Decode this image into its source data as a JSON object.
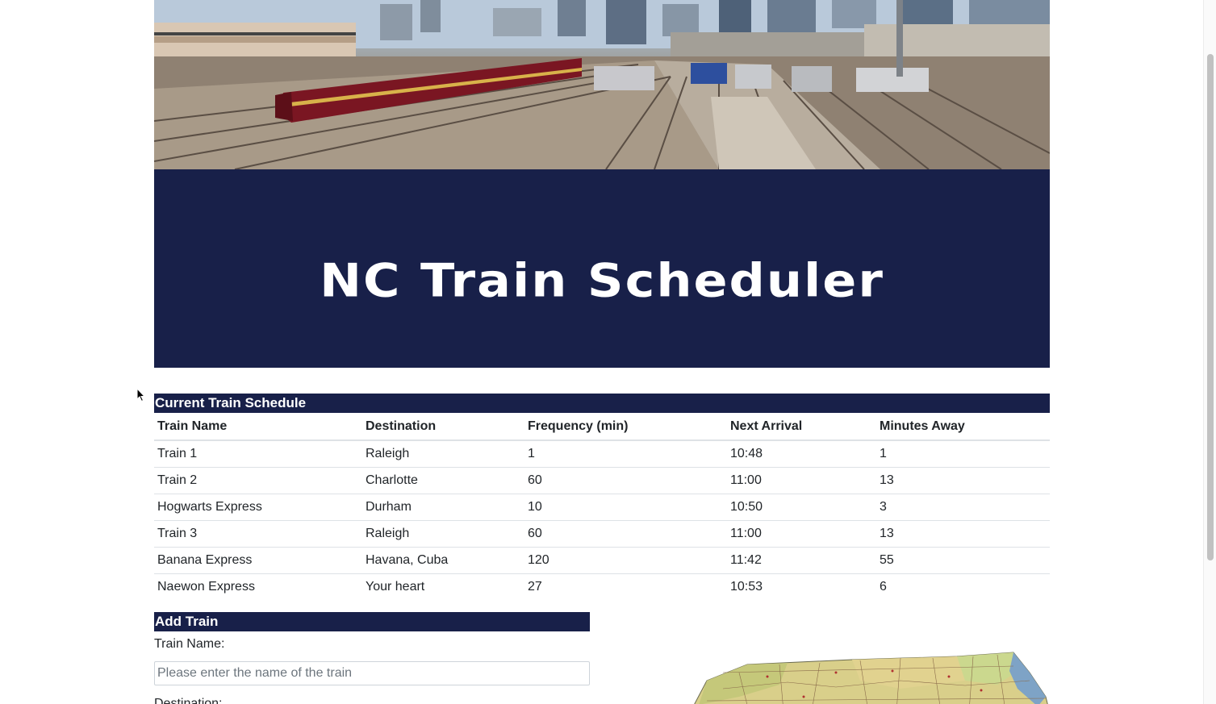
{
  "banner": {
    "title": "NC Train Scheduler"
  },
  "schedule": {
    "header": "Current Train Schedule",
    "columns": [
      "Train Name",
      "Destination",
      "Frequency (min)",
      "Next Arrival",
      "Minutes Away"
    ],
    "rows": [
      [
        "Train 1",
        "Raleigh",
        "1",
        "10:48",
        "1"
      ],
      [
        "Train 2",
        "Charlotte",
        "60",
        "11:00",
        "13"
      ],
      [
        "Hogwarts Express",
        "Durham",
        "10",
        "10:50",
        "3"
      ],
      [
        "Train 3",
        "Raleigh",
        "60",
        "11:00",
        "13"
      ],
      [
        "Banana Express",
        "Havana, Cuba",
        "120",
        "11:42",
        "55"
      ],
      [
        "Naewon Express",
        "Your heart",
        "27",
        "10:53",
        "6"
      ]
    ]
  },
  "add_train": {
    "header": "Add Train",
    "train_name_label": "Train Name:",
    "train_name_placeholder": "Please enter the name of the train",
    "destination_label": "Destination:"
  },
  "colors": {
    "navy": "#182049",
    "white": "#ffffff"
  }
}
